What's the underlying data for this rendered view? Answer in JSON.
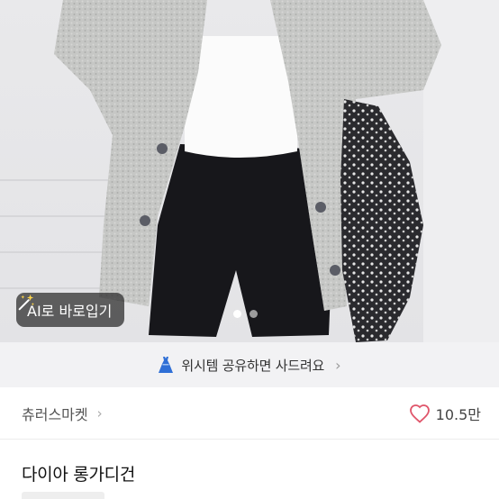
{
  "ai_button": {
    "label": "AI로 바로입기",
    "icon": "magic-wand-icon"
  },
  "carousel": {
    "total": 2,
    "current": 1
  },
  "wish_banner": {
    "icon": "dress-icon",
    "text": "위시템 공유하면 사드려요",
    "accent": "#2f6fd6"
  },
  "shop": {
    "name": "츄러스마켓",
    "likes": "10.5만",
    "heart_color": "#e0566b"
  },
  "product": {
    "title": "다이아 롱가디건"
  }
}
